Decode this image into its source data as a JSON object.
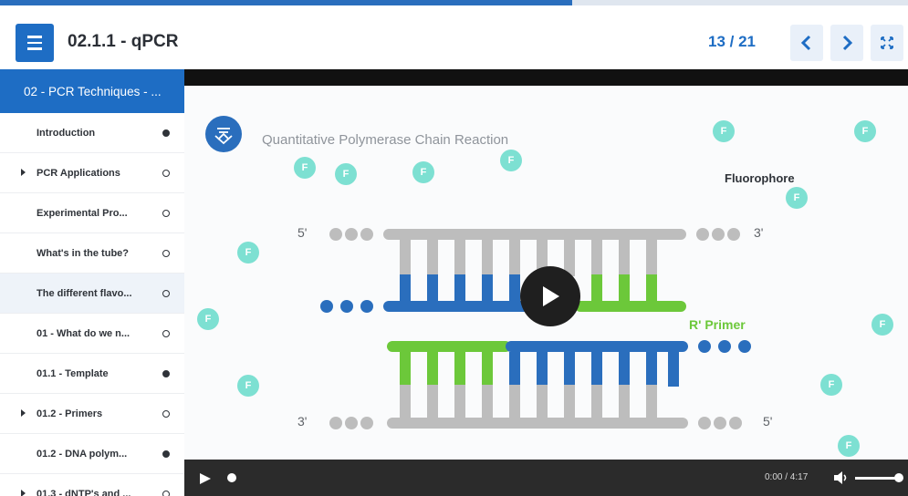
{
  "progress": {
    "fraction": 0.63
  },
  "header": {
    "title": "02.1.1 - qPCR",
    "page_counter": "13 / 21"
  },
  "sidebar": {
    "section_title": "02 - PCR Techniques - ...",
    "items": [
      {
        "label": "Introduction",
        "has_children": false,
        "status": "complete"
      },
      {
        "label": "PCR Applications",
        "has_children": true,
        "status": "incomplete"
      },
      {
        "label": "Experimental Pro...",
        "has_children": false,
        "status": "incomplete"
      },
      {
        "label": "What's in the tube?",
        "has_children": false,
        "status": "incomplete"
      },
      {
        "label": "The different flavo...",
        "has_children": false,
        "status": "incomplete",
        "active": true
      },
      {
        "label": "01 - What do we n...",
        "has_children": false,
        "status": "incomplete"
      },
      {
        "label": "01.1 - Template",
        "has_children": false,
        "status": "complete"
      },
      {
        "label": "01.2 - Primers",
        "has_children": true,
        "status": "incomplete"
      },
      {
        "label": "01.2 - DNA polym...",
        "has_children": false,
        "status": "complete"
      },
      {
        "label": "01.3 - dNTP's and ...",
        "has_children": true,
        "status": "incomplete"
      }
    ]
  },
  "video": {
    "title": "Quantitative Polymerase Chain Reaction",
    "fluorophore_label": "Fluorophore",
    "fluorophore_letter": "F",
    "primer_label": "R' Primer",
    "ends": {
      "top_left": "5'",
      "top_right": "3'",
      "bottom_left": "3'",
      "bottom_right": "5'"
    },
    "time_display": "0:00 / 4:17",
    "colors": {
      "blue": "#2a6ebd",
      "green": "#6cc83a",
      "gray": "#bdbdbd",
      "fluorophore": "#7de0d2"
    }
  }
}
